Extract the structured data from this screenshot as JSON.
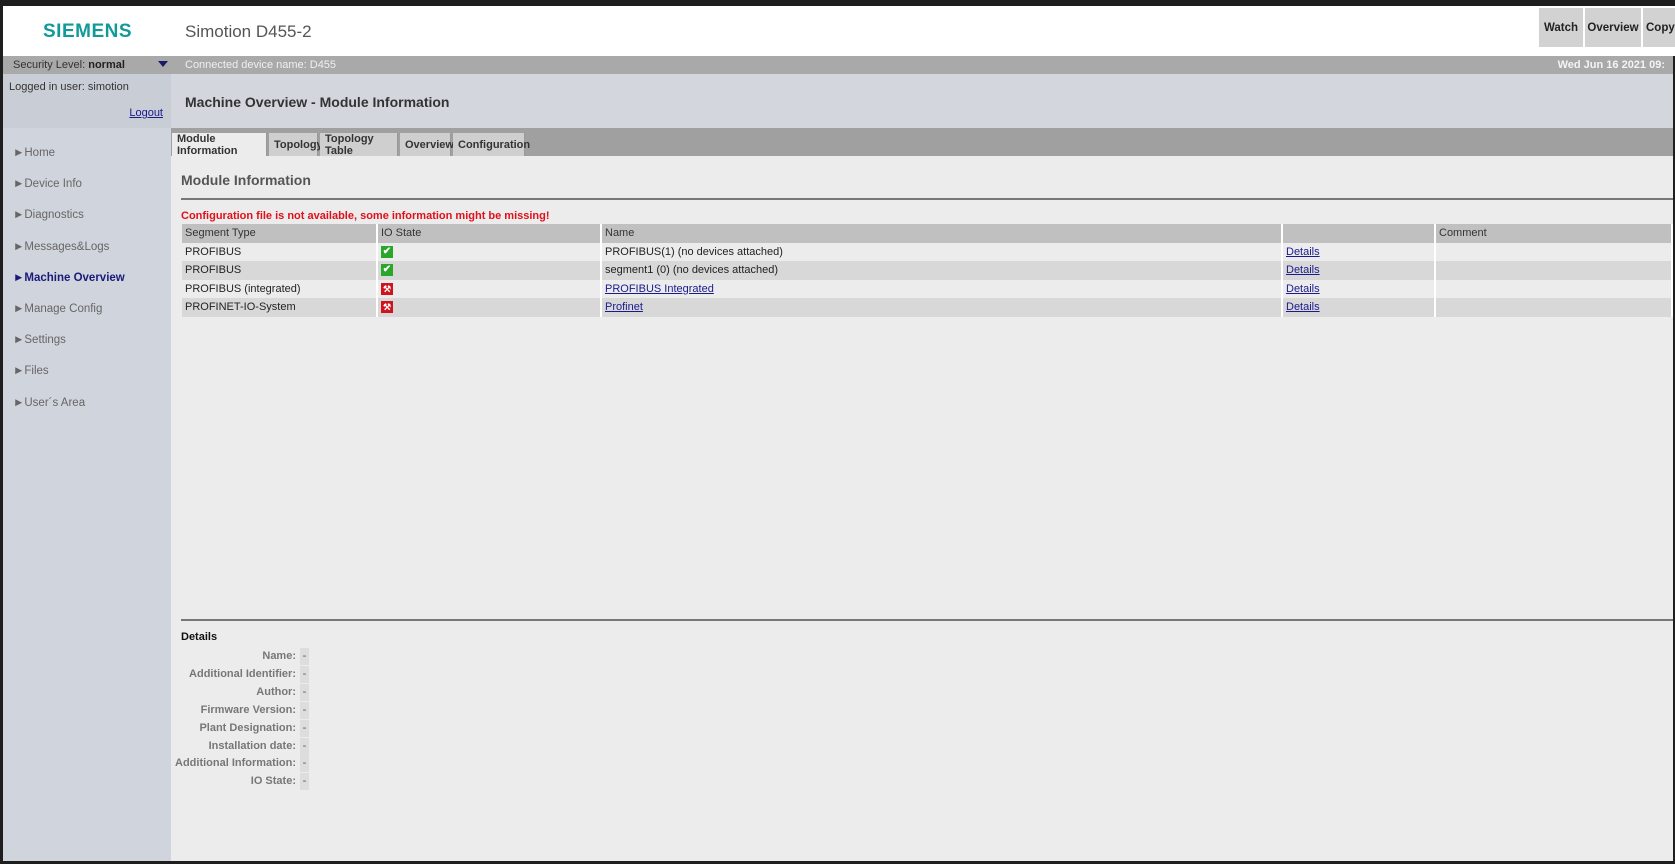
{
  "header": {
    "logo": "SIEMENS",
    "title": "Simotion D455-2",
    "buttons": [
      "Watch",
      "Overview",
      "Copy"
    ]
  },
  "statusbar": {
    "security_label": "Security Level:",
    "security_value": "normal",
    "device_name": "Connected device name: D455",
    "datetime": "Wed Jun 16 2021  09:"
  },
  "sidebar": {
    "logged_in": "Logged in user: simotion",
    "logout": "Logout",
    "items": [
      {
        "label": "►Home"
      },
      {
        "label": "►Device Info"
      },
      {
        "label": "►Diagnostics"
      },
      {
        "label": "►Messages&Logs"
      },
      {
        "label": "►Machine Overview",
        "active": true
      },
      {
        "label": "►Manage Config"
      },
      {
        "label": "►Settings"
      },
      {
        "label": "►Files"
      },
      {
        "label": "►User´s Area"
      }
    ]
  },
  "page": {
    "title": "Machine Overview - Module Information",
    "tabs": [
      "Module Information",
      "Topology",
      "Topology Table",
      "Overview",
      "Configuration"
    ],
    "section_title": "Module Information",
    "warning": "Configuration file is not available, some information might be missing!",
    "colors": {
      "warning": "#e0101a",
      "ok": "#2aa62a",
      "error": "#d0141e",
      "logo": "#129a9a"
    },
    "table": {
      "headers": [
        "Segment Type",
        "IO State",
        "Name",
        "",
        "Comment"
      ],
      "rows": [
        {
          "type": "PROFIBUS",
          "state": "ok",
          "name": "PROFIBUS(1) (no devices attached)",
          "name_link": false,
          "details": "Details",
          "comment": ""
        },
        {
          "type": "PROFIBUS",
          "state": "ok",
          "name": "segment1 (0) (no devices attached)",
          "name_link": false,
          "details": "Details",
          "comment": ""
        },
        {
          "type": "PROFIBUS (integrated)",
          "state": "error",
          "name": "PROFIBUS Integrated",
          "name_link": true,
          "details": "Details",
          "comment": ""
        },
        {
          "type": "PROFINET-IO-System",
          "state": "error",
          "name": "Profinet",
          "name_link": true,
          "details": "Details",
          "comment": ""
        }
      ]
    },
    "details": {
      "title": "Details",
      "fields": [
        {
          "label": "Name:",
          "value": "-"
        },
        {
          "label": "Additional Identifier:",
          "value": "-"
        },
        {
          "label": "Author:",
          "value": "-"
        },
        {
          "label": "Firmware Version:",
          "value": "-"
        },
        {
          "label": "Plant Designation:",
          "value": "-"
        },
        {
          "label": "Installation date:",
          "value": "-"
        },
        {
          "label": "Additional Information:",
          "value": "-"
        },
        {
          "label": "IO State:",
          "value": "-"
        }
      ]
    }
  }
}
